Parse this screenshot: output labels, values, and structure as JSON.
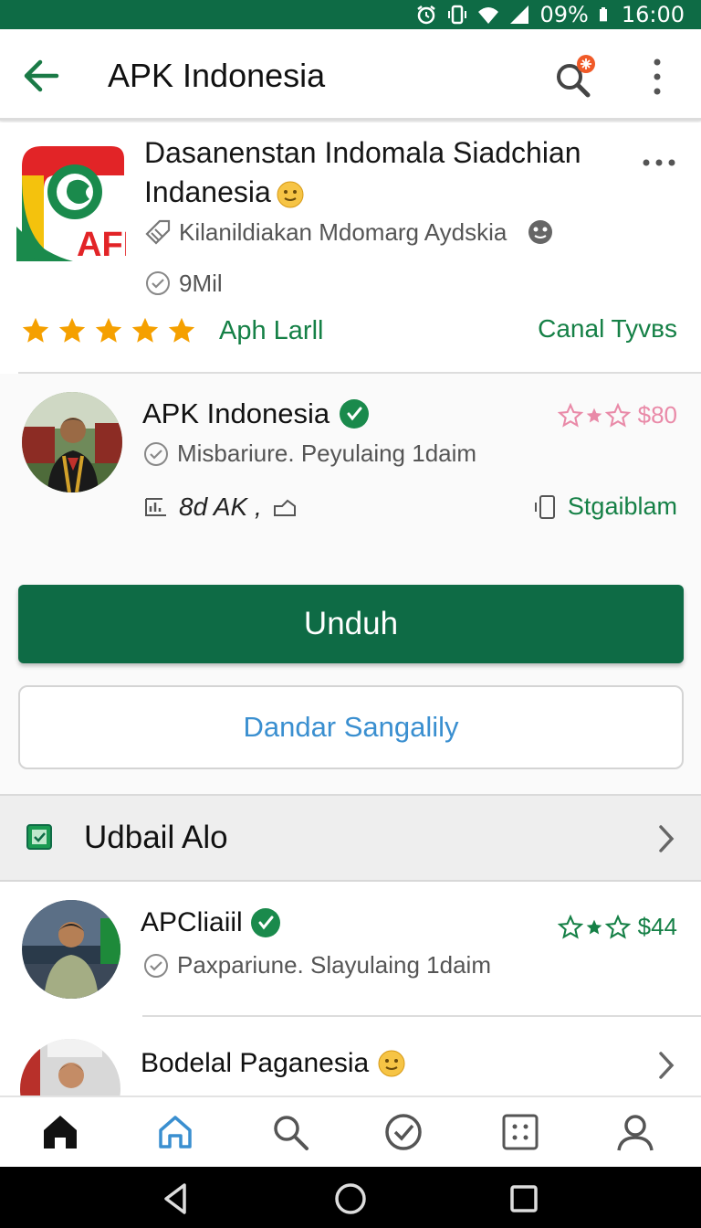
{
  "status_bar": {
    "battery": "09%",
    "time": "16:00"
  },
  "app_bar": {
    "title": "APK Indonesia",
    "icons": [
      "back-arrow-icon",
      "search-notification-icon",
      "more-vertical-icon"
    ]
  },
  "app_card": {
    "logo_text": "AFP",
    "name": "Dasanenstan Indomala Siadchian Indanesia",
    "developer": "Kilanildiakan Mdomarg Aydskia",
    "size": "9Mil",
    "stars": 5,
    "rating_label": "Aph Larll",
    "category_link": "Canal Tyvвs"
  },
  "publisher": {
    "name": "APK Indonesia",
    "rating_text": "$80",
    "description": "Misbariure. Peyulaing 1daim",
    "stats": "8d AK ,",
    "storage": "Stgaiblam"
  },
  "buttons": {
    "primary": "Unduh",
    "secondary": "Dandar Sangalily"
  },
  "section": {
    "title": "Udbail Alo"
  },
  "list_items": [
    {
      "name": "APCliaiil",
      "rating_text": "$44",
      "description": "Paxpariune. Slayulaing 1daim"
    },
    {
      "name": "Bodelal Paganesia"
    }
  ],
  "colors": {
    "brand_green": "#0e6b45",
    "accent_green": "#158046",
    "star_orange": "#f5a000",
    "link_blue": "#3a8fd0",
    "pink_star": "#e98aa8"
  }
}
